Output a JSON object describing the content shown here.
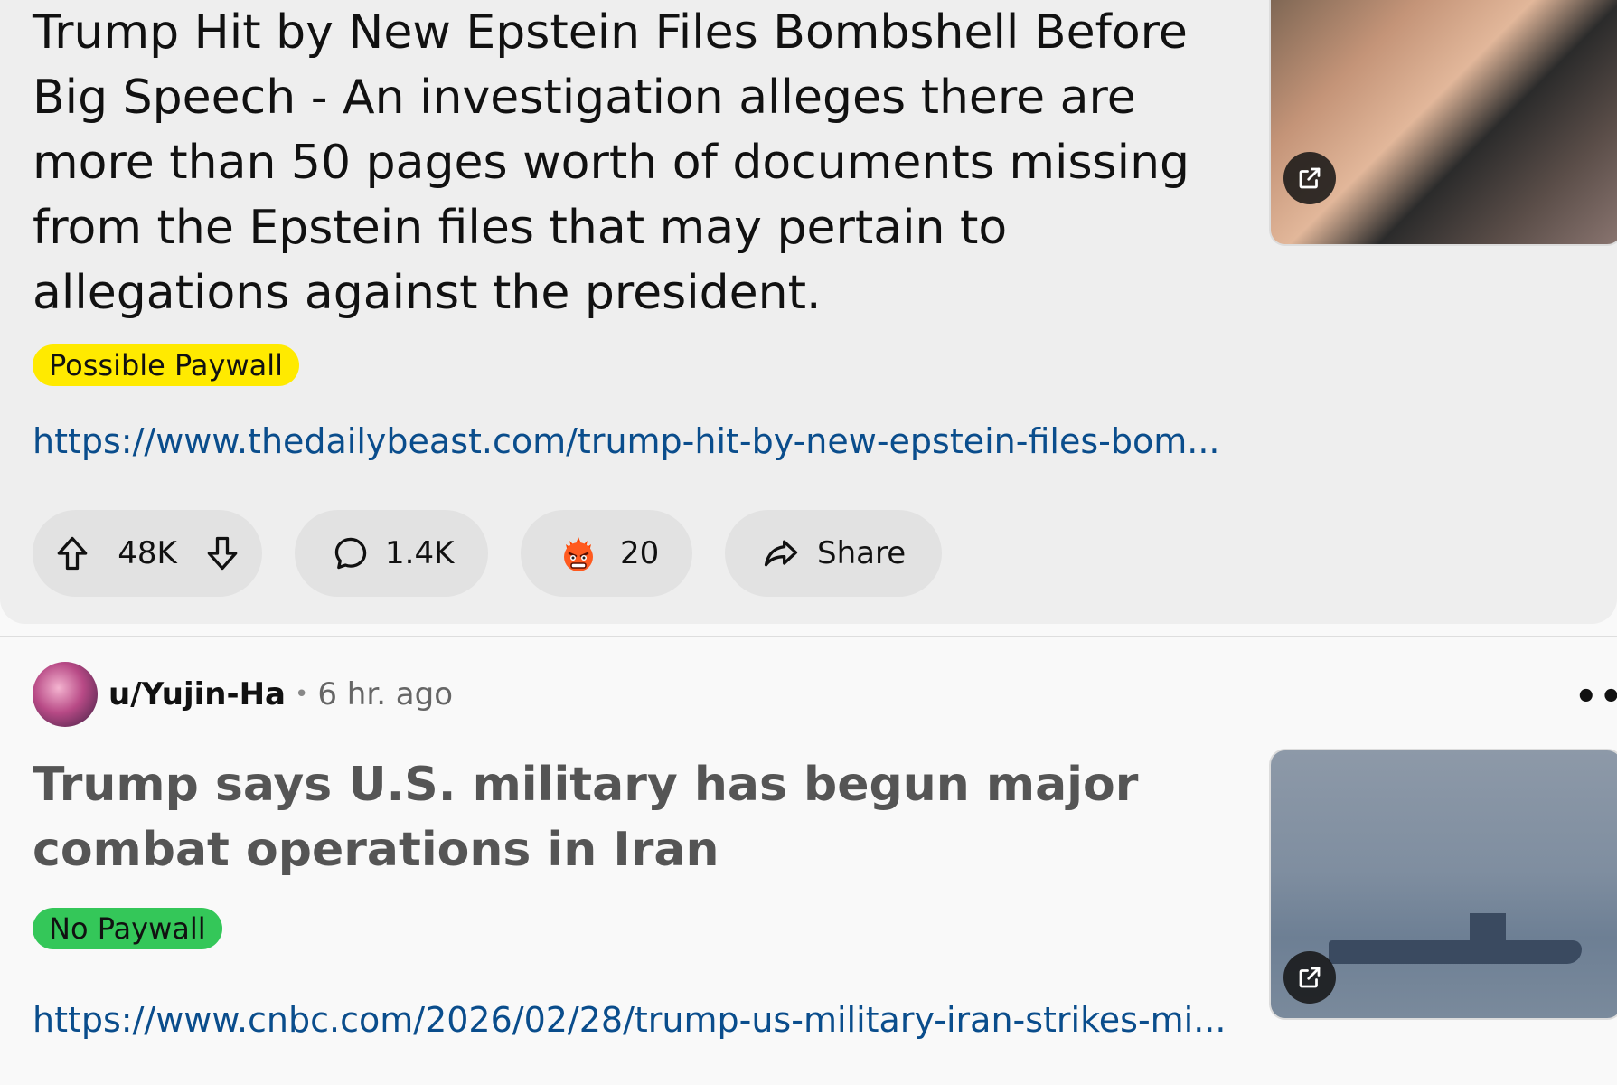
{
  "post1": {
    "title": "Trump Hit by New Epstein Files Bombshell Before Big Speech - An investigation alleges there are more than 50 pages worth of documents missing from the Epstein files that may pertain to allegations against the president.",
    "flair": "Possible Paywall",
    "flair_color": "#ffea00",
    "link": "https://www.thedailybeast.com/trump-hit-by-new-epstein-files-bom...",
    "votes": "48K",
    "comments": "1.4K",
    "awards": "20",
    "share_label": "Share",
    "icons": {
      "upvote": "upvote-arrow-icon",
      "downvote": "downvote-arrow-icon",
      "comment": "comment-bubble-icon",
      "award": "angry-face-icon",
      "share": "share-arrow-icon",
      "external": "external-link-icon"
    }
  },
  "post2": {
    "author": "u/Yujin-Ha",
    "separator": "•",
    "time": "6 hr. ago",
    "more": "•••",
    "title": "Trump says U.S. military has begun major combat operations in Iran",
    "flair": "No Paywall",
    "flair_color": "#34c759",
    "link": "https://www.cnbc.com/2026/02/28/trump-us-military-iran-strikes-mi..."
  },
  "colors": {
    "link": "#0a4d8c",
    "hovered_post_bg": "#eeeeee",
    "page_bg": "#f9f9f9"
  }
}
